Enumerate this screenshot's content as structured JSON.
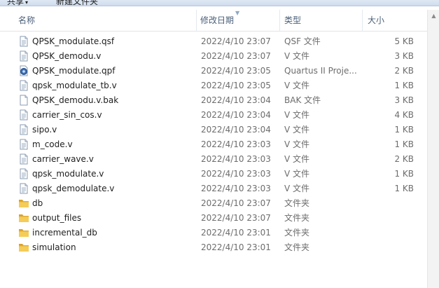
{
  "toolbar": {
    "share": "共享",
    "new_folder": "新建文件夹"
  },
  "columns": {
    "name": "名称",
    "date": "修改日期",
    "type": "类型",
    "size": "大小"
  },
  "files": [
    {
      "name": "QPSK_modulate.qsf",
      "date": "2022/4/10 23:07",
      "type": "QSF 文件",
      "size": "5 KB",
      "icon": "doc"
    },
    {
      "name": "QPSK_demodu.v",
      "date": "2022/4/10 23:07",
      "type": "V 文件",
      "size": "3 KB",
      "icon": "doc"
    },
    {
      "name": "QPSK_modulate.qpf",
      "date": "2022/4/10 23:05",
      "type": "Quartus II Proje...",
      "size": "2 KB",
      "icon": "quartus"
    },
    {
      "name": "qpsk_modulate_tb.v",
      "date": "2022/4/10 23:05",
      "type": "V 文件",
      "size": "1 KB",
      "icon": "doc"
    },
    {
      "name": "QPSK_demodu.v.bak",
      "date": "2022/4/10 23:04",
      "type": "BAK 文件",
      "size": "3 KB",
      "icon": "blank"
    },
    {
      "name": "carrier_sin_cos.v",
      "date": "2022/4/10 23:04",
      "type": "V 文件",
      "size": "4 KB",
      "icon": "doc"
    },
    {
      "name": "sipo.v",
      "date": "2022/4/10 23:04",
      "type": "V 文件",
      "size": "1 KB",
      "icon": "doc"
    },
    {
      "name": "m_code.v",
      "date": "2022/4/10 23:03",
      "type": "V 文件",
      "size": "1 KB",
      "icon": "doc"
    },
    {
      "name": "carrier_wave.v",
      "date": "2022/4/10 23:03",
      "type": "V 文件",
      "size": "2 KB",
      "icon": "doc"
    },
    {
      "name": "qpsk_modulate.v",
      "date": "2022/4/10 23:03",
      "type": "V 文件",
      "size": "1 KB",
      "icon": "doc"
    },
    {
      "name": "qpsk_demodulate.v",
      "date": "2022/4/10 23:03",
      "type": "V 文件",
      "size": "1 KB",
      "icon": "doc"
    },
    {
      "name": "db",
      "date": "2022/4/10 23:07",
      "type": "文件夹",
      "size": "",
      "icon": "folder"
    },
    {
      "name": "output_files",
      "date": "2022/4/10 23:07",
      "type": "文件夹",
      "size": "",
      "icon": "folder"
    },
    {
      "name": "incremental_db",
      "date": "2022/4/10 23:01",
      "type": "文件夹",
      "size": "",
      "icon": "folder"
    },
    {
      "name": "simulation",
      "date": "2022/4/10 23:01",
      "type": "文件夹",
      "size": "",
      "icon": "folder"
    }
  ],
  "colors": {
    "header_text": "#4c607a",
    "folder": "#e8b840",
    "meta_text": "#6d6d6d"
  }
}
